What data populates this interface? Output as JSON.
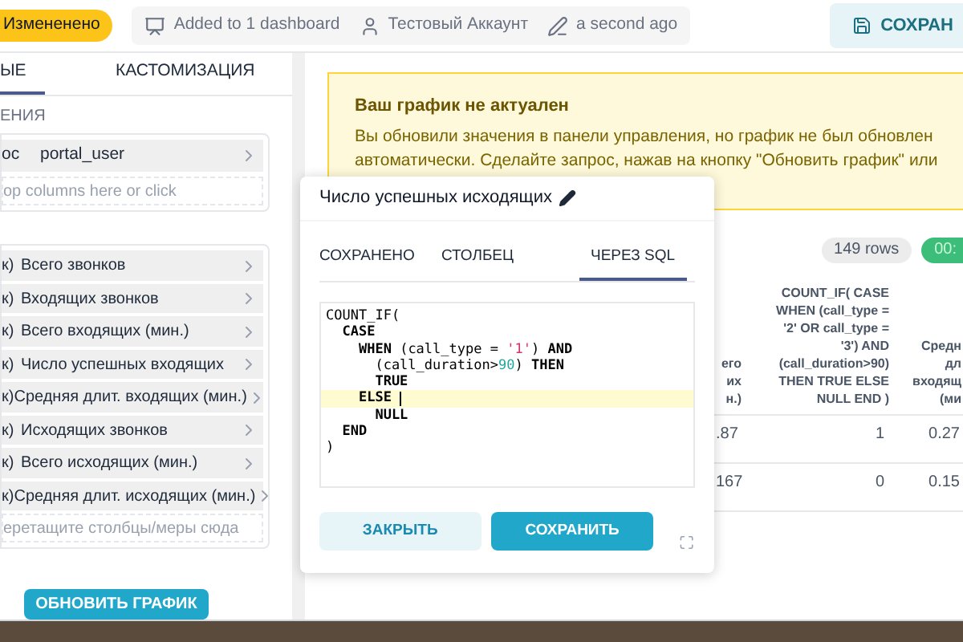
{
  "header": {
    "status_badge": "Измененено",
    "meta": [
      {
        "kind": "dashboard",
        "text": "Added to 1 dashboard"
      },
      {
        "kind": "user",
        "text": "Тестовый Аккаунт"
      },
      {
        "kind": "edited",
        "text": "a second ago"
      }
    ],
    "save_button": "СОХРАН"
  },
  "sidebar": {
    "tabs": [
      {
        "label": "ЫЕ",
        "selected": true
      },
      {
        "label": "КАСТОМИЗАЦИЯ",
        "selected": false
      }
    ],
    "section_label": "ЕНИЯ",
    "source": {
      "prefix": "ос",
      "name": "portal_user"
    },
    "source_dropzone": "op columns here or click",
    "metrics": [
      {
        "prefix": "к)",
        "name": "Всего звонков"
      },
      {
        "prefix": "к)",
        "name": "Входящих звонков"
      },
      {
        "prefix": "к)",
        "name": "Всего входящих (мин.)"
      },
      {
        "prefix": "к)",
        "name": "Число успешных входящих"
      },
      {
        "prefix": "к)",
        "name": "Средняя длит. входящих (мин.)"
      },
      {
        "prefix": "к)",
        "name": "Исходящих звонков"
      },
      {
        "prefix": "к)",
        "name": "Всего исходящих (мин.)"
      },
      {
        "prefix": "к)",
        "name": "Средняя длит. исходящих (мин.)"
      }
    ],
    "metrics_dropzone": "еретащите столбцы/меры сюда",
    "update_button": "ОБНОВИТЬ ГРАФИК"
  },
  "alert": {
    "title": "Ваш график не актуален",
    "text": "Вы обновили значения в панели управления, но график не был обновлен автоматически. Сделайте запрос, нажав на кнопку \"Обновить график\" или"
  },
  "results": {
    "row_count": "149 rows",
    "timer": "00:",
    "columns": [
      {
        "lines": [
          "его",
          "их",
          "н.)"
        ]
      },
      {
        "lines": [
          "COUNT_IF( CASE",
          "WHEN (call_type =",
          "'2' OR call_type =",
          "'3') AND",
          "(call_duration>90)",
          "THEN TRUE ELSE",
          "NULL END )"
        ]
      },
      {
        "lines": [
          "Средн",
          "дл",
          "входящ",
          "(ми"
        ]
      }
    ],
    "rows": [
      [
        ".87",
        "1",
        "0.27"
      ],
      [
        "167",
        "0",
        "0.15"
      ]
    ]
  },
  "popover": {
    "title": "Число успешных исходящих",
    "tabs": [
      {
        "label": "СОХРАНЕНО",
        "selected": false
      },
      {
        "label": "СТОЛБЕЦ",
        "selected": false
      },
      {
        "label": "ЧЕРЕЗ SQL",
        "selected": true
      }
    ],
    "code": [
      {
        "highlighted": false,
        "tokens": [
          {
            "text": "COUNT_IF(",
            "kind": "plain"
          }
        ]
      },
      {
        "highlighted": false,
        "tokens": [
          {
            "text": "  CASE",
            "kind": "keyword"
          }
        ]
      },
      {
        "highlighted": false,
        "tokens": [
          {
            "text": "    WHEN",
            "kind": "keyword"
          },
          {
            "text": " (call_type = ",
            "kind": "plain"
          },
          {
            "text": "'1'",
            "kind": "string"
          },
          {
            "text": ") ",
            "kind": "plain"
          },
          {
            "text": "AND",
            "kind": "keyword"
          }
        ]
      },
      {
        "highlighted": false,
        "tokens": [
          {
            "text": "      (call_duration>",
            "kind": "plain"
          },
          {
            "text": "90",
            "kind": "number"
          },
          {
            "text": ") ",
            "kind": "plain"
          },
          {
            "text": "THEN",
            "kind": "keyword"
          }
        ]
      },
      {
        "highlighted": false,
        "tokens": [
          {
            "text": "      TRUE",
            "kind": "keyword"
          }
        ]
      },
      {
        "highlighted": true,
        "tokens": [
          {
            "text": "    ELSE ",
            "kind": "keyword"
          }
        ]
      },
      {
        "highlighted": false,
        "tokens": [
          {
            "text": "      NULL",
            "kind": "keyword"
          }
        ]
      },
      {
        "highlighted": false,
        "tokens": [
          {
            "text": "  END",
            "kind": "keyword"
          }
        ]
      },
      {
        "highlighted": false,
        "tokens": [
          {
            "text": ")",
            "kind": "plain"
          }
        ]
      }
    ],
    "close_button": "ЗАКРЫТЬ",
    "save_button": "СОХРАНИТЬ"
  }
}
